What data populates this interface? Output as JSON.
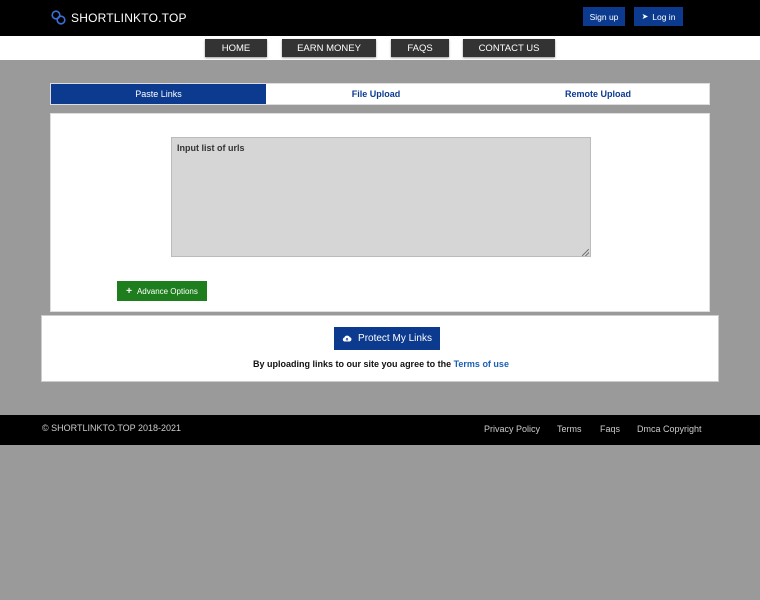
{
  "header": {
    "logo_text": "SHORTLINKTO.TOP",
    "signup_label": "Sign up",
    "login_label": "Log in"
  },
  "nav": {
    "items": [
      {
        "label": "HOME"
      },
      {
        "label": "EARN MONEY"
      },
      {
        "label": "FAQS"
      },
      {
        "label": "CONTACT US"
      }
    ]
  },
  "tabs": {
    "items": [
      {
        "label": "Paste Links",
        "active": true
      },
      {
        "label": "File Upload",
        "active": false
      },
      {
        "label": "Remote Upload",
        "active": false
      }
    ]
  },
  "form": {
    "urls_placeholder": "Input list of urls",
    "advance_options_label": "Advance Options",
    "protect_label": "Protect My Links",
    "agree_text": "By uploading links to our site you agree to the",
    "terms_link": "Terms of use"
  },
  "footer": {
    "copyright": "© SHORTLINKTO.TOP 2018-2021",
    "links": [
      {
        "label": "Privacy Policy"
      },
      {
        "label": "Terms"
      },
      {
        "label": "Faqs"
      },
      {
        "label": "Dmca Copyright"
      }
    ]
  },
  "colors": {
    "brand_blue": "#0b3a8f",
    "green": "#1e7e1e",
    "page_bg": "#9a9a9a"
  },
  "icons": {
    "logo": "link-chain-icon",
    "login": "sign-in-icon",
    "advance": "plus-icon",
    "protect": "cloud-upload-icon"
  }
}
